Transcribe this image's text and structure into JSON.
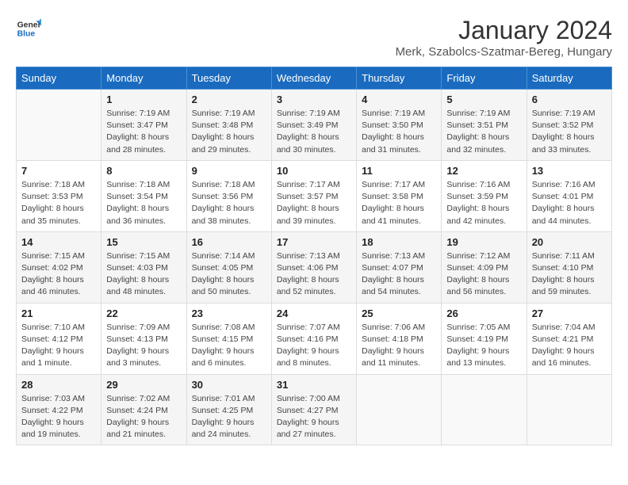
{
  "logo": {
    "line1": "General",
    "line2": "Blue"
  },
  "title": "January 2024",
  "subtitle": "Merk, Szabolcs-Szatmar-Bereg, Hungary",
  "days_of_week": [
    "Sunday",
    "Monday",
    "Tuesday",
    "Wednesday",
    "Thursday",
    "Friday",
    "Saturday"
  ],
  "weeks": [
    [
      {
        "day": "",
        "info": ""
      },
      {
        "day": "1",
        "info": "Sunrise: 7:19 AM\nSunset: 3:47 PM\nDaylight: 8 hours\nand 28 minutes."
      },
      {
        "day": "2",
        "info": "Sunrise: 7:19 AM\nSunset: 3:48 PM\nDaylight: 8 hours\nand 29 minutes."
      },
      {
        "day": "3",
        "info": "Sunrise: 7:19 AM\nSunset: 3:49 PM\nDaylight: 8 hours\nand 30 minutes."
      },
      {
        "day": "4",
        "info": "Sunrise: 7:19 AM\nSunset: 3:50 PM\nDaylight: 8 hours\nand 31 minutes."
      },
      {
        "day": "5",
        "info": "Sunrise: 7:19 AM\nSunset: 3:51 PM\nDaylight: 8 hours\nand 32 minutes."
      },
      {
        "day": "6",
        "info": "Sunrise: 7:19 AM\nSunset: 3:52 PM\nDaylight: 8 hours\nand 33 minutes."
      }
    ],
    [
      {
        "day": "7",
        "info": "Sunrise: 7:18 AM\nSunset: 3:53 PM\nDaylight: 8 hours\nand 35 minutes."
      },
      {
        "day": "8",
        "info": "Sunrise: 7:18 AM\nSunset: 3:54 PM\nDaylight: 8 hours\nand 36 minutes."
      },
      {
        "day": "9",
        "info": "Sunrise: 7:18 AM\nSunset: 3:56 PM\nDaylight: 8 hours\nand 38 minutes."
      },
      {
        "day": "10",
        "info": "Sunrise: 7:17 AM\nSunset: 3:57 PM\nDaylight: 8 hours\nand 39 minutes."
      },
      {
        "day": "11",
        "info": "Sunrise: 7:17 AM\nSunset: 3:58 PM\nDaylight: 8 hours\nand 41 minutes."
      },
      {
        "day": "12",
        "info": "Sunrise: 7:16 AM\nSunset: 3:59 PM\nDaylight: 8 hours\nand 42 minutes."
      },
      {
        "day": "13",
        "info": "Sunrise: 7:16 AM\nSunset: 4:01 PM\nDaylight: 8 hours\nand 44 minutes."
      }
    ],
    [
      {
        "day": "14",
        "info": "Sunrise: 7:15 AM\nSunset: 4:02 PM\nDaylight: 8 hours\nand 46 minutes."
      },
      {
        "day": "15",
        "info": "Sunrise: 7:15 AM\nSunset: 4:03 PM\nDaylight: 8 hours\nand 48 minutes."
      },
      {
        "day": "16",
        "info": "Sunrise: 7:14 AM\nSunset: 4:05 PM\nDaylight: 8 hours\nand 50 minutes."
      },
      {
        "day": "17",
        "info": "Sunrise: 7:13 AM\nSunset: 4:06 PM\nDaylight: 8 hours\nand 52 minutes."
      },
      {
        "day": "18",
        "info": "Sunrise: 7:13 AM\nSunset: 4:07 PM\nDaylight: 8 hours\nand 54 minutes."
      },
      {
        "day": "19",
        "info": "Sunrise: 7:12 AM\nSunset: 4:09 PM\nDaylight: 8 hours\nand 56 minutes."
      },
      {
        "day": "20",
        "info": "Sunrise: 7:11 AM\nSunset: 4:10 PM\nDaylight: 8 hours\nand 59 minutes."
      }
    ],
    [
      {
        "day": "21",
        "info": "Sunrise: 7:10 AM\nSunset: 4:12 PM\nDaylight: 9 hours\nand 1 minute."
      },
      {
        "day": "22",
        "info": "Sunrise: 7:09 AM\nSunset: 4:13 PM\nDaylight: 9 hours\nand 3 minutes."
      },
      {
        "day": "23",
        "info": "Sunrise: 7:08 AM\nSunset: 4:15 PM\nDaylight: 9 hours\nand 6 minutes."
      },
      {
        "day": "24",
        "info": "Sunrise: 7:07 AM\nSunset: 4:16 PM\nDaylight: 9 hours\nand 8 minutes."
      },
      {
        "day": "25",
        "info": "Sunrise: 7:06 AM\nSunset: 4:18 PM\nDaylight: 9 hours\nand 11 minutes."
      },
      {
        "day": "26",
        "info": "Sunrise: 7:05 AM\nSunset: 4:19 PM\nDaylight: 9 hours\nand 13 minutes."
      },
      {
        "day": "27",
        "info": "Sunrise: 7:04 AM\nSunset: 4:21 PM\nDaylight: 9 hours\nand 16 minutes."
      }
    ],
    [
      {
        "day": "28",
        "info": "Sunrise: 7:03 AM\nSunset: 4:22 PM\nDaylight: 9 hours\nand 19 minutes."
      },
      {
        "day": "29",
        "info": "Sunrise: 7:02 AM\nSunset: 4:24 PM\nDaylight: 9 hours\nand 21 minutes."
      },
      {
        "day": "30",
        "info": "Sunrise: 7:01 AM\nSunset: 4:25 PM\nDaylight: 9 hours\nand 24 minutes."
      },
      {
        "day": "31",
        "info": "Sunrise: 7:00 AM\nSunset: 4:27 PM\nDaylight: 9 hours\nand 27 minutes."
      },
      {
        "day": "",
        "info": ""
      },
      {
        "day": "",
        "info": ""
      },
      {
        "day": "",
        "info": ""
      }
    ]
  ]
}
